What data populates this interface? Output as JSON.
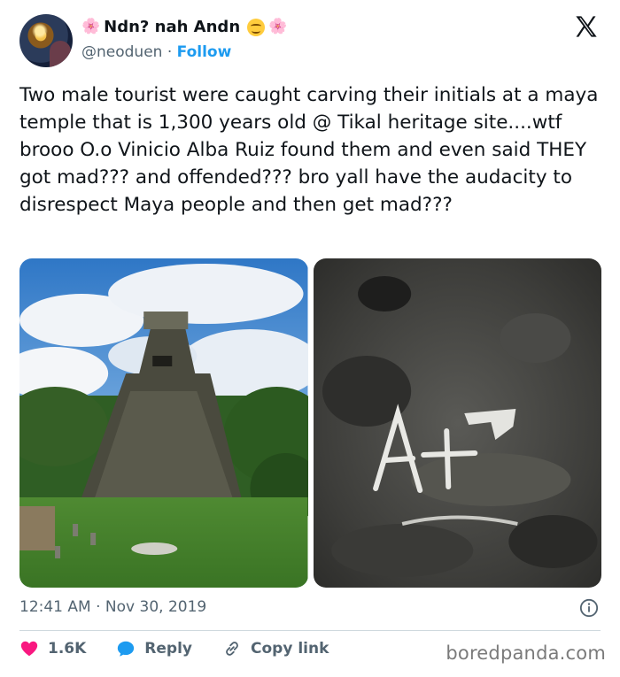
{
  "user": {
    "display_name": "Ndn? nah Andn",
    "handle": "@neoduen",
    "separator": "·",
    "follow_label": "Follow"
  },
  "tweet": {
    "text": "Two male tourist were caught carving their initials at a maya temple that is 1,300 years old @ Tikal heritage site....wtf brooo O.o Vinicio Alba Ruiz found them and even said THEY got mad??? and offended??? bro yall have the audacity to disrespect Maya people and then get mad???",
    "time": "12:41 AM",
    "separator": "·",
    "date": "Nov 30, 2019"
  },
  "actions": {
    "likes": "1.6K",
    "reply_label": "Reply",
    "copy_label": "Copy link"
  },
  "icons": {
    "like": "heart-icon",
    "reply": "speech-bubble-icon",
    "copy": "link-icon",
    "info": "info-icon",
    "brand": "x-logo-icon",
    "name_emojis": [
      "flower-emoji",
      "smiling-face-emoji",
      "flower-emoji"
    ]
  },
  "colors": {
    "text": "#0f1419",
    "secondary": "#536471",
    "accent": "#1d9bf0",
    "like": "#f91880",
    "divider": "#cfd9de"
  },
  "watermark": "boredpanda.com"
}
